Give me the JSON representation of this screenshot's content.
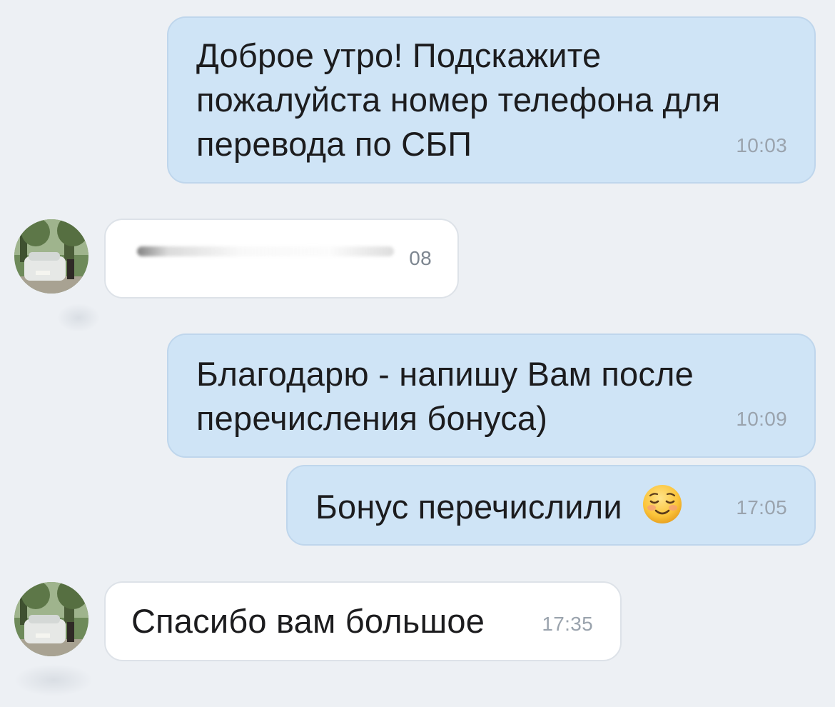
{
  "messages": [
    {
      "id": "m1",
      "direction": "outgoing",
      "text": "Доброе утро! Подскажите\nпожалуйста номер телефона для\nперевода по СБП",
      "time": "10:03"
    },
    {
      "id": "m2",
      "direction": "incoming",
      "text": "",
      "time": "08",
      "redacted": true
    },
    {
      "id": "m3",
      "direction": "outgoing",
      "text": "Благодарю - напишу Вам после\nперечисления бонуса)",
      "time": "10:09"
    },
    {
      "id": "m4",
      "direction": "outgoing",
      "text": "Бонус перечислили",
      "emoji": "relieved-smiling-face",
      "time": "17:05"
    },
    {
      "id": "m5",
      "direction": "incoming",
      "text": "Спасибо вам большое",
      "time": "17:35"
    }
  ],
  "colors": {
    "background": "#edf0f4",
    "outgoing_bubble": "#cfe4f6",
    "incoming_bubble": "#ffffff",
    "timestamp": "#9aa3ad"
  },
  "avatar": {
    "icon": "avatar-photo-white-car"
  }
}
